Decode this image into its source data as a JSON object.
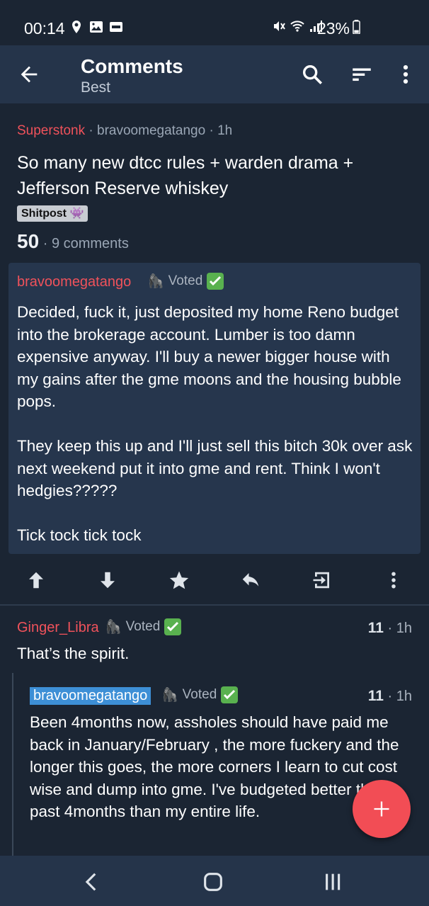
{
  "status_bar": {
    "time": "00:14",
    "battery": "23%",
    "icons_left": [
      "location-icon",
      "image-icon",
      "notification-app-icon"
    ],
    "icons_right": [
      "mute-icon",
      "wifi-icon",
      "signal-icon",
      "battery-icon"
    ]
  },
  "app_bar": {
    "title": "Comments",
    "subtitle": "Best"
  },
  "post": {
    "subreddit": "Superstonk",
    "separator": " · ",
    "author": "bravoomegatango",
    "age": "1h",
    "title": "So many new dtcc rules + warden drama + Jefferson Reserve whiskey",
    "flair": "Shitpost 👾",
    "score": "50",
    "comments": "9 comments",
    "selftext": {
      "author": "bravoomegatango",
      "flair_emoji": "🦍",
      "flair_text": "Voted",
      "body": "Decided, fuck it, just deposited my home Reno budget into the brokerage account. Lumber is too damn expensive anyway. I'll buy a newer bigger house with my gains after the gme moons and the housing bubble pops.\n\nThey keep this up and I'll just sell this bitch 30k over ask next weekend put it into gme and rent. Think I won't hedgies?????\n\nTick tock tick tock"
    }
  },
  "comments": [
    {
      "author": "Ginger_Libra",
      "flair_emoji": "🦍",
      "flair_text": "Voted",
      "score": "11",
      "age": "· 1h",
      "body": "That’s the spirit."
    },
    {
      "author": "bravoomegatango",
      "flair_emoji": "🦍",
      "flair_text": "Voted",
      "score": "11",
      "age": "· 1h",
      "body": "Been 4months now, assholes should have paid me back in January/February , the more fuckery and the longer this goes, the more corners I learn to cut cost wise and dump into gme. I've budgeted better these past 4months than my entire life."
    }
  ],
  "colors": {
    "background": "#1b2533",
    "app_bar": "#25344a",
    "accent_red": "#f0525b",
    "op_highlight": "#3d8fd6",
    "fab": "#f24d55"
  }
}
